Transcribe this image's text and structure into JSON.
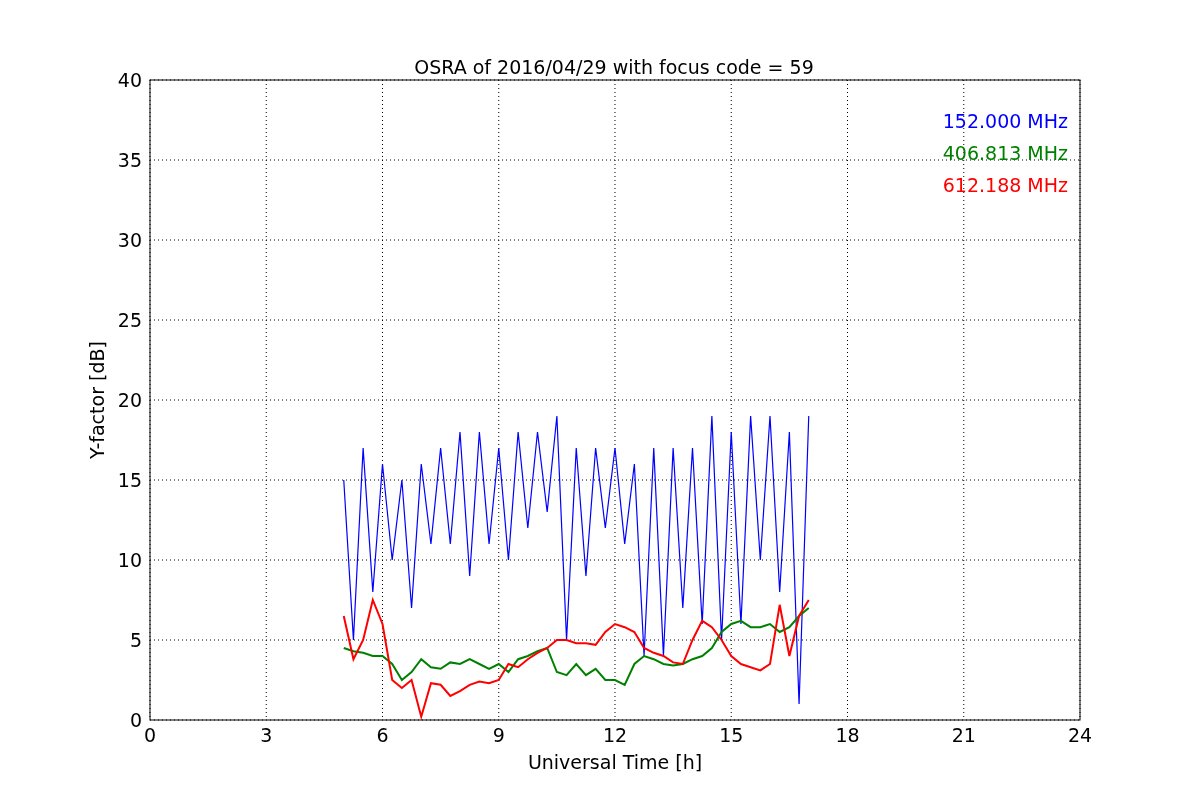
{
  "chart_data": {
    "type": "line",
    "title": "OSRA of 2016/04/29 with focus code = 59",
    "xlabel": "Universal Time [h]",
    "ylabel": "Y-factor [dB]",
    "grid": true,
    "xlim": [
      0,
      24
    ],
    "ylim": [
      0,
      40
    ],
    "xticks": [
      0,
      3,
      6,
      9,
      12,
      15,
      18,
      21,
      24
    ],
    "yticks": [
      0,
      5,
      10,
      15,
      20,
      25,
      30,
      35,
      40
    ],
    "x": [
      5,
      5.25,
      5.5,
      5.75,
      6,
      6.25,
      6.5,
      6.75,
      7,
      7.25,
      7.5,
      7.75,
      8,
      8.25,
      8.5,
      8.75,
      9,
      9.25,
      9.5,
      9.75,
      10,
      10.25,
      10.5,
      10.75,
      11,
      11.25,
      11.5,
      11.75,
      12,
      12.25,
      12.5,
      12.75,
      13,
      13.25,
      13.5,
      13.75,
      14,
      14.25,
      14.5,
      14.75,
      15,
      15.25,
      15.5,
      15.75,
      16,
      16.25,
      16.5,
      16.75,
      17
    ],
    "series": [
      {
        "name": "152.000 MHz",
        "color": "#0000ff",
        "values": [
          15,
          5,
          17,
          8,
          16,
          10,
          15,
          7,
          16,
          11,
          17,
          11,
          18,
          9,
          18,
          11,
          17,
          10,
          18,
          12,
          18,
          13,
          19,
          5,
          17,
          9,
          17,
          12,
          17,
          11,
          16,
          4,
          17,
          4,
          17,
          7,
          17,
          6,
          19,
          5,
          18,
          6,
          19,
          10,
          19,
          8,
          18,
          1,
          19
        ]
      },
      {
        "name": "406.813 MHz",
        "color": "#008000",
        "values": [
          4.5,
          4.3,
          4.2,
          4,
          4,
          3.5,
          2.5,
          3,
          3.8,
          3.3,
          3.2,
          3.6,
          3.5,
          3.8,
          3.5,
          3.2,
          3.5,
          3,
          3.8,
          4,
          4.3,
          4.5,
          3,
          2.8,
          3.5,
          2.8,
          3.2,
          2.5,
          2.5,
          2.2,
          3.5,
          4,
          3.8,
          3.5,
          3.4,
          3.5,
          3.8,
          4,
          4.5,
          5.5,
          6,
          6.2,
          5.8,
          5.8,
          6,
          5.5,
          5.8,
          6.5,
          7
        ]
      },
      {
        "name": "612.188 MHz",
        "color": "#ff0000",
        "values": [
          6.5,
          3.8,
          5,
          7.5,
          6,
          2.5,
          2,
          2.5,
          0.2,
          2.3,
          2.2,
          1.5,
          1.8,
          2.2,
          2.4,
          2.3,
          2.5,
          3.5,
          3.3,
          3.8,
          4.2,
          4.5,
          5,
          5,
          4.8,
          4.8,
          4.7,
          5.5,
          6,
          5.8,
          5.5,
          4.5,
          4.2,
          4,
          3.6,
          3.5,
          5,
          6.2,
          5.8,
          5,
          4,
          3.5,
          3.3,
          3.1,
          3.5,
          7.2,
          4,
          6.5,
          7.5
        ]
      }
    ]
  }
}
